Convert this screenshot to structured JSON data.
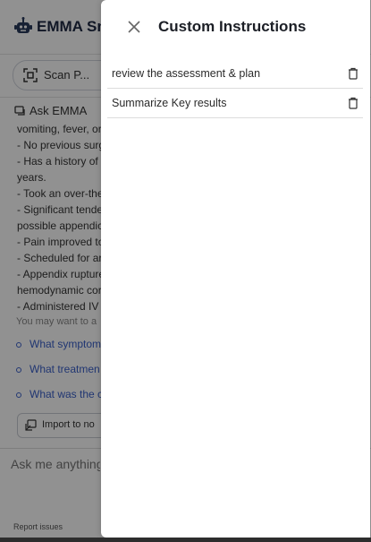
{
  "app": {
    "title": "EMMA Sm",
    "scan_button_label": "Scan P...",
    "ask_label": "Ask EMMA",
    "note_lines": [
      "vomiting, fever, or",
      "- No previous surg",
      "- Has a history of",
      "years.",
      "- Took an over-the",
      "- Significant tende",
      "possible appendic",
      "- Pain improved to",
      "- Scheduled for ar",
      "- Appendix rupture",
      "hemodynamic cor",
      "- Administered IV"
    ],
    "suggestions_title": "You may want to a",
    "suggestions": [
      "What symptom",
      "What treatmen",
      "What was the c"
    ],
    "import_button_label": "Import to no",
    "composer_placeholder": "Ask me anything",
    "report_link": "Report issues"
  },
  "drawer": {
    "title": "Custom Instructions",
    "instructions": [
      {
        "text": "review the assessment & plan"
      },
      {
        "text": "Summarize Key results"
      }
    ]
  },
  "icons": {
    "close": "close-icon",
    "delete": "trash-icon",
    "logo": "robot-icon",
    "scan": "scan-icon",
    "ask": "chat-icon",
    "import": "import-icon"
  },
  "colors": {
    "link": "#3a60c9",
    "overlay": "rgba(0,0,0,0.43)",
    "title": "#1c1f26"
  }
}
